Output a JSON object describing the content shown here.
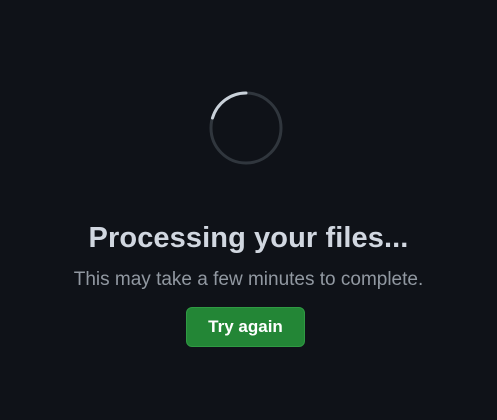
{
  "loading": {
    "title": "Processing your files...",
    "subtitle": "This may take a few minutes to complete.",
    "retry_button_label": "Try again",
    "spinner_icon": "loading-spinner-icon"
  },
  "colors": {
    "background": "#0f1218",
    "title_text": "#d1d7e0",
    "subtitle_text": "#9198a1",
    "button_background": "#238636",
    "spinner_track": "#30363d",
    "spinner_arc": "#c9d1d9"
  }
}
